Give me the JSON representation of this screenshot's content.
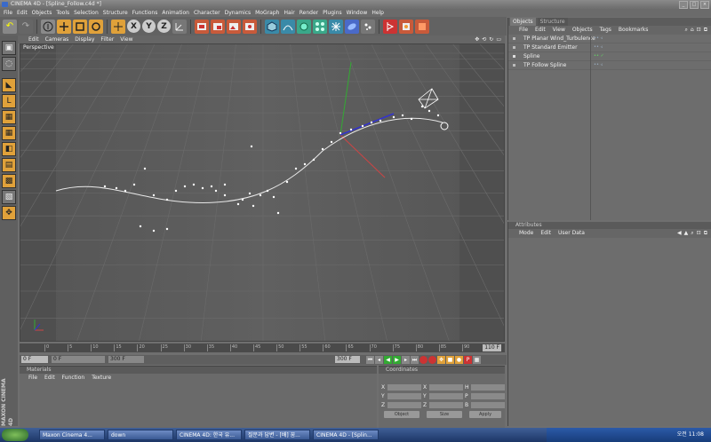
{
  "window": {
    "title": "CINEMA 4D - [Spline_Follow.c4d *]",
    "controls": [
      "_",
      "□",
      "×"
    ]
  },
  "menubar": [
    "File",
    "Edit",
    "Objects",
    "Tools",
    "Selection",
    "Structure",
    "Functions",
    "Animation",
    "Character",
    "Dynamics",
    "MoGraph",
    "Hair",
    "Render",
    "Plugins",
    "Window",
    "Help"
  ],
  "toolbar": {
    "undo": "↶",
    "redo": "↷",
    "x": "X",
    "y": "Y",
    "z": "Z"
  },
  "viewport": {
    "menu": [
      "Edit",
      "Cameras",
      "Display",
      "Filter",
      "View"
    ],
    "label": "Perspective",
    "icons": [
      "✥",
      "⟲",
      "↻",
      "▭"
    ]
  },
  "timeline": {
    "ticks": [
      "0",
      "5",
      "10",
      "15",
      "20",
      "25",
      "30",
      "35",
      "40",
      "45",
      "50",
      "55",
      "60",
      "65",
      "70",
      "75",
      "80",
      "85",
      "90"
    ],
    "end_frame": "110 F"
  },
  "transport": {
    "current": "0 F",
    "start": "0 F",
    "end": "300 F",
    "max": "300 F"
  },
  "materials": {
    "header": "Materials",
    "menu": [
      "File",
      "Edit",
      "Function",
      "Texture"
    ]
  },
  "coordinates": {
    "header": "Coordinates",
    "rows": [
      {
        "a": "X",
        "b": "X",
        "c": "H"
      },
      {
        "a": "Y",
        "b": "Y",
        "c": "P"
      },
      {
        "a": "Z",
        "b": "Z",
        "c": "B"
      }
    ],
    "mode": "Object",
    "size": "Size",
    "apply": "Apply"
  },
  "objects_panel": {
    "tabs": [
      "Objects",
      "Structure"
    ],
    "menu": [
      "File",
      "Edit",
      "View",
      "Objects",
      "Tags",
      "Bookmarks"
    ],
    "items": [
      "TP Planar Wind_Turbulence",
      "TP Standard Emitter",
      "Spline",
      "TP Follow Spline"
    ]
  },
  "attributes_panel": {
    "header": "Attributes",
    "menu": [
      "Mode",
      "Edit",
      "User Data"
    ]
  },
  "taskbar": {
    "items": [
      "Maxon Cinema 4...",
      "down",
      "CINEMA 4D: 한국 유...",
      "질문과 답변 - [배] 꿈...",
      "CINEMA 4D - [Splin..."
    ],
    "clock": "오전 11:08"
  },
  "brand": "MAXON CINEMA 4D"
}
